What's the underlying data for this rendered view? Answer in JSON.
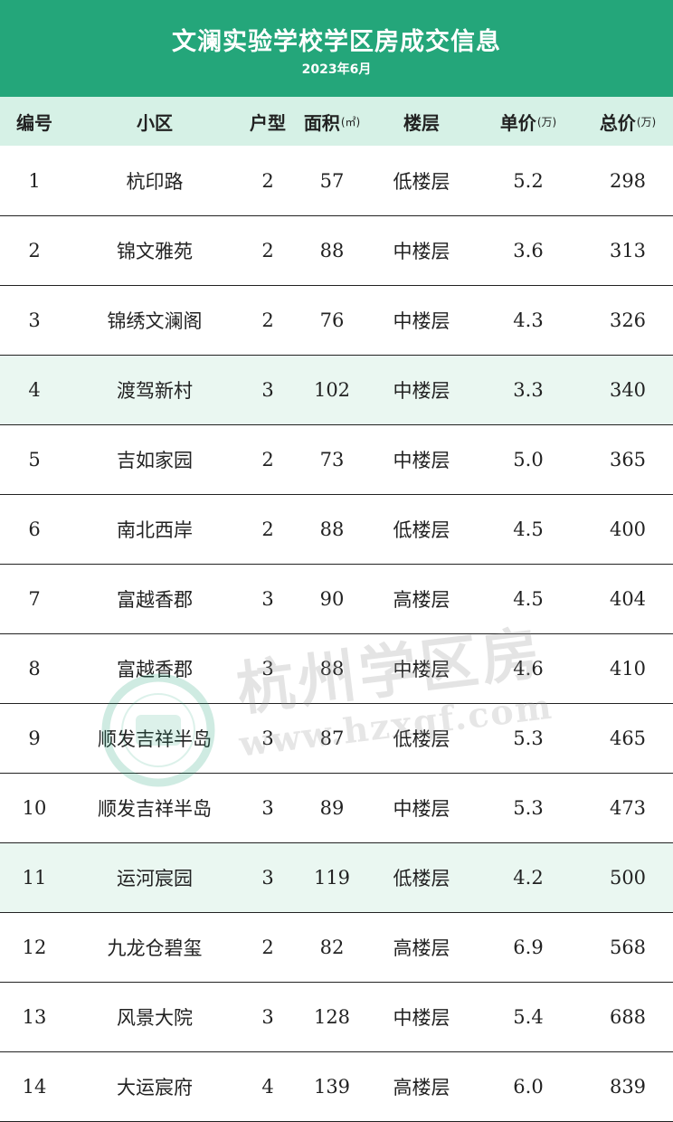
{
  "banner": {
    "title": "文澜实验学校学区房成交信息",
    "subtitle": "2023年6月",
    "color": "#24a67a"
  },
  "header": {
    "col_no": "编号",
    "col_community": "小区",
    "col_layout": "户型",
    "col_area": "面积",
    "col_area_unit": "(㎡)",
    "col_floor": "楼层",
    "col_unit_price": "单价",
    "col_unit_price_unit": "(万)",
    "col_total": "总价",
    "col_total_unit": "(万)",
    "color": "#d6f1e6"
  },
  "rows": [
    {
      "no": "1",
      "community": "杭印路",
      "layout": "2",
      "area": "57",
      "floor": "低楼层",
      "unit_price": "5.2",
      "total": "298",
      "highlight": false
    },
    {
      "no": "2",
      "community": "锦文雅苑",
      "layout": "2",
      "area": "88",
      "floor": "中楼层",
      "unit_price": "3.6",
      "total": "313",
      "highlight": false
    },
    {
      "no": "3",
      "community": "锦绣文澜阁",
      "layout": "2",
      "area": "76",
      "floor": "中楼层",
      "unit_price": "4.3",
      "total": "326",
      "highlight": false
    },
    {
      "no": "4",
      "community": "渡驾新村",
      "layout": "3",
      "area": "102",
      "floor": "中楼层",
      "unit_price": "3.3",
      "total": "340",
      "highlight": true
    },
    {
      "no": "5",
      "community": "吉如家园",
      "layout": "2",
      "area": "73",
      "floor": "中楼层",
      "unit_price": "5.0",
      "total": "365",
      "highlight": false
    },
    {
      "no": "6",
      "community": "南北西岸",
      "layout": "2",
      "area": "88",
      "floor": "低楼层",
      "unit_price": "4.5",
      "total": "400",
      "highlight": false
    },
    {
      "no": "7",
      "community": "富越香郡",
      "layout": "3",
      "area": "90",
      "floor": "高楼层",
      "unit_price": "4.5",
      "total": "404",
      "highlight": false
    },
    {
      "no": "8",
      "community": "富越香郡",
      "layout": "3",
      "area": "88",
      "floor": "中楼层",
      "unit_price": "4.6",
      "total": "410",
      "highlight": false
    },
    {
      "no": "9",
      "community": "顺发吉祥半岛",
      "layout": "3",
      "area": "87",
      "floor": "低楼层",
      "unit_price": "5.3",
      "total": "465",
      "highlight": false
    },
    {
      "no": "10",
      "community": "顺发吉祥半岛",
      "layout": "3",
      "area": "89",
      "floor": "中楼层",
      "unit_price": "5.3",
      "total": "473",
      "highlight": false
    },
    {
      "no": "11",
      "community": "运河宸园",
      "layout": "3",
      "area": "119",
      "floor": "低楼层",
      "unit_price": "4.2",
      "total": "500",
      "highlight": true
    },
    {
      "no": "12",
      "community": "九龙仓碧玺",
      "layout": "2",
      "area": "82",
      "floor": "高楼层",
      "unit_price": "6.9",
      "total": "568",
      "highlight": false
    },
    {
      "no": "13",
      "community": "风景大院",
      "layout": "3",
      "area": "128",
      "floor": "中楼层",
      "unit_price": "5.4",
      "total": "688",
      "highlight": false
    },
    {
      "no": "14",
      "community": "大运宸府",
      "layout": "4",
      "area": "139",
      "floor": "高楼层",
      "unit_price": "6.0",
      "total": "839",
      "highlight": false
    }
  ],
  "watermark": {
    "text": "杭州学区房",
    "url": "www.hzxqf.com",
    "seal_icon": "hangzhou-xuequ-seal-icon"
  }
}
